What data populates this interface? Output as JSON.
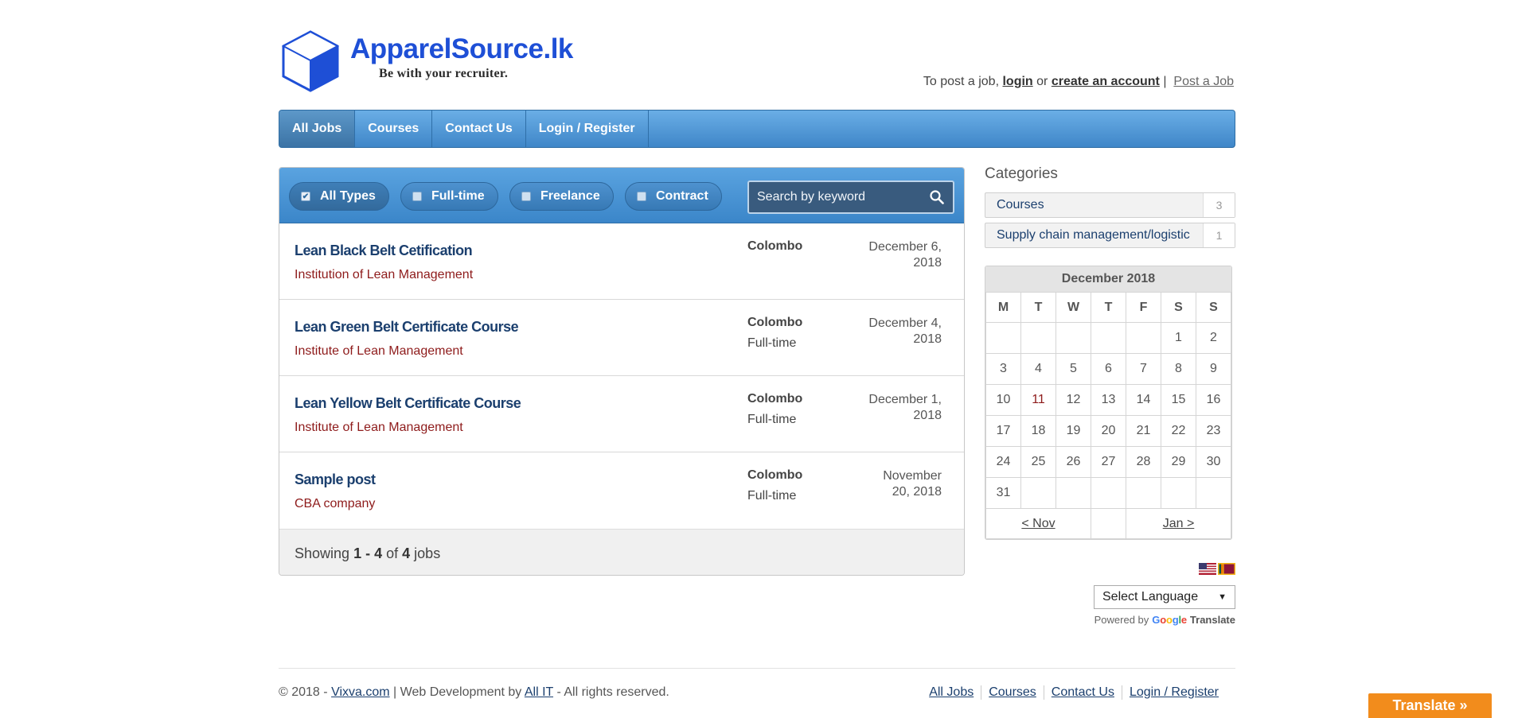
{
  "brand": {
    "name": "ApparelSource.lk",
    "tagline": "Be with your recruiter."
  },
  "header": {
    "intro": "To post a job,",
    "login": "login",
    "or": "or",
    "create_account": "create an account",
    "separator": "|",
    "post_job": "Post a Job"
  },
  "nav": {
    "items": [
      {
        "label": "All Jobs",
        "active": true
      },
      {
        "label": "Courses"
      },
      {
        "label": "Contact Us"
      },
      {
        "label": "Login / Register"
      }
    ]
  },
  "filters": {
    "types": [
      {
        "label": "All Types",
        "checked": true
      },
      {
        "label": "Full-time",
        "checked": false
      },
      {
        "label": "Freelance",
        "checked": false
      },
      {
        "label": "Contract",
        "checked": false
      }
    ],
    "search_placeholder": "Search by keyword"
  },
  "jobs": [
    {
      "title": "Lean Black Belt Cetification",
      "company": "Institution of Lean Management",
      "location": "Colombo",
      "type": "",
      "date_line1": "December 6,",
      "date_line2": "2018"
    },
    {
      "title": "Lean Green Belt Certificate Course",
      "company": "Institute of Lean Management",
      "location": "Colombo",
      "type": "Full-time",
      "date_line1": "December 4,",
      "date_line2": "2018"
    },
    {
      "title": "Lean Yellow Belt Certificate Course",
      "company": "Institute of Lean Management",
      "location": "Colombo",
      "type": "Full-time",
      "date_line1": "December 1,",
      "date_line2": "2018"
    },
    {
      "title": "Sample post",
      "company": "CBA company",
      "location": "Colombo",
      "type": "Full-time",
      "date_line1": "November",
      "date_line2": "20, 2018"
    }
  ],
  "listing_footer": {
    "showing": "Showing",
    "range": "1 - 4",
    "of": "of",
    "total": "4",
    "unit": "jobs"
  },
  "sidebar": {
    "title": "Categories",
    "categories": [
      {
        "label": "Courses",
        "count": "3"
      },
      {
        "label": "Supply chain management/logistic",
        "count": "1"
      }
    ],
    "calendar": {
      "month": "December 2018",
      "weekdays": [
        "M",
        "T",
        "W",
        "T",
        "F",
        "S",
        "S"
      ],
      "weeks": [
        [
          "",
          "",
          "",
          "",
          "",
          "1",
          "2"
        ],
        [
          "3",
          "4",
          "5",
          "6",
          "7",
          "8",
          "9"
        ],
        [
          "10",
          "11",
          "12",
          "13",
          "14",
          "15",
          "16"
        ],
        [
          "17",
          "18",
          "19",
          "20",
          "21",
          "22",
          "23"
        ],
        [
          "24",
          "25",
          "26",
          "27",
          "28",
          "29",
          "30"
        ],
        [
          "31",
          "",
          "",
          "",
          "",
          "",
          ""
        ]
      ],
      "prev": "< Nov",
      "next": "Jan >"
    },
    "language_select": "Select Language",
    "powered_by": "Powered by",
    "google": "Google",
    "translate": "Translate"
  },
  "footer": {
    "copy_prefix": "© 2018 -",
    "site_link": "Vixva.com",
    "dev_text": "| Web Development by",
    "dev_link": "All IT",
    "rights": "- All rights reserved.",
    "nav": [
      "All Jobs",
      "Courses",
      "Contact Us",
      "Login / Register"
    ]
  },
  "translate_button": "Translate »",
  "colors": {
    "nav_blue": "#3f86c8",
    "brand_blue": "#1e4fd6",
    "link_navy": "#1b3f6e",
    "company_red": "#8e1b1b",
    "translate_orange": "#f28c1c"
  }
}
